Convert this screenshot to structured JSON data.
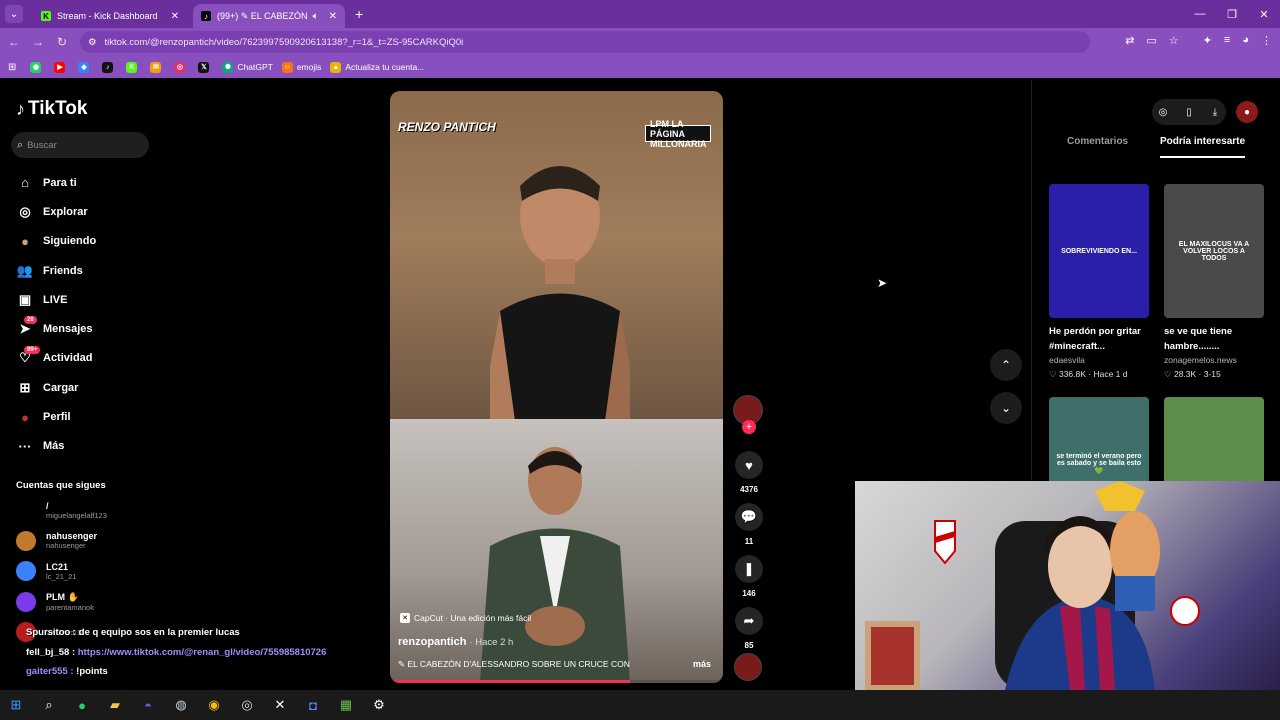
{
  "browser": {
    "tabs": [
      {
        "title": "Stream - Kick Dashboard",
        "favicon": "K",
        "favicon_color": "#53fc18"
      },
      {
        "title": "(99+) ✎ EL CABEZÓN D'",
        "favicon": "♪",
        "favicon_color": "#000000"
      }
    ],
    "url": "tiktok.com/@renzopantich/video/7623997590920613138?_r=1&_t=ZS-95CARKQiQ0i",
    "bookmarks": [
      {
        "label": "",
        "icon": "whatsapp-icon",
        "glyph": "◉",
        "color": "#25d366"
      },
      {
        "label": "",
        "icon": "youtube-icon",
        "glyph": "▶",
        "color": "#ff0000"
      },
      {
        "label": "",
        "icon": "messenger-icon",
        "glyph": "◈",
        "color": "#3b82f6"
      },
      {
        "label": "",
        "icon": "tiktok-icon",
        "glyph": "♪",
        "color": "#111111"
      },
      {
        "label": "",
        "icon": "kick-icon",
        "glyph": "K",
        "color": "#53fc18"
      },
      {
        "label": "",
        "icon": "mail-icon",
        "glyph": "✉",
        "color": "#f59e0b"
      },
      {
        "label": "",
        "icon": "instagram-icon",
        "glyph": "◎",
        "color": "#e1306c"
      },
      {
        "label": "",
        "icon": "x-icon",
        "glyph": "𝕏",
        "color": "#111111"
      },
      {
        "label": "ChatGPT",
        "icon": "chatgpt-icon",
        "glyph": "✺",
        "color": "#10a37f"
      },
      {
        "label": "emojis",
        "icon": "emoji-icon",
        "glyph": "☺",
        "color": "#f97316"
      },
      {
        "label": "Actualiza tu cuenta...",
        "icon": "bookmark-icon",
        "glyph": "▲",
        "color": "#eab308"
      }
    ]
  },
  "tiktok": {
    "logo": "TikTok",
    "search_placeholder": "Buscar",
    "menu": [
      {
        "label": "Para ti",
        "icon": "home-icon",
        "glyph": "⌂"
      },
      {
        "label": "Explorar",
        "icon": "compass-icon",
        "glyph": "◎"
      },
      {
        "label": "Siguiendo",
        "icon": "following-avatar-icon",
        "glyph": "●"
      },
      {
        "label": "Friends",
        "icon": "friends-icon",
        "glyph": "👥"
      },
      {
        "label": "LIVE",
        "icon": "live-icon",
        "glyph": "▣"
      },
      {
        "label": "Mensajes",
        "icon": "messages-icon",
        "glyph": "➤",
        "badge": "26"
      },
      {
        "label": "Actividad",
        "icon": "activity-icon",
        "glyph": "♡",
        "badge": "99+"
      },
      {
        "label": "Cargar",
        "icon": "upload-icon",
        "glyph": "⊞"
      },
      {
        "label": "Perfil",
        "icon": "profile-icon",
        "glyph": "●"
      },
      {
        "label": "Más",
        "icon": "more-icon",
        "glyph": "···"
      }
    ],
    "following_title": "Cuentas que sigues",
    "following": [
      {
        "name": "/",
        "handle": "miguelangelalf123",
        "color": "#000000"
      },
      {
        "name": "nahusenger",
        "handle": "nahusenger",
        "color": "#c2772f"
      },
      {
        "name": "LC21",
        "handle": "lc_21_21",
        "color": "#3b82f6"
      },
      {
        "name": "PLM ✋",
        "handle": "parentamanok",
        "color": "#7c3aed"
      },
      {
        "name": "",
        "handle": "benitosdr10",
        "color": "#b91c1c"
      }
    ]
  },
  "video": {
    "watermark": "RENZO PANTICH",
    "lpm_label": "LPM LA PÁGINA MILLONARIA",
    "capcut": "CapCut · Una edición más fácil",
    "author": "renzopantich",
    "time": "· Hace 2 h",
    "description": "✎ EL CABEZÓN D'ALESSANDRO SOBRE UN CRUCE CON",
    "more": "más",
    "progress": 0.72,
    "actions": [
      {
        "name": "like",
        "icon": "heart-icon",
        "glyph": "♥",
        "count": "4376"
      },
      {
        "name": "comment",
        "icon": "comment-icon",
        "glyph": "💬",
        "count": "11"
      },
      {
        "name": "save",
        "icon": "bookmark-icon",
        "glyph": "❚",
        "count": "146"
      },
      {
        "name": "share",
        "icon": "share-icon",
        "glyph": "➦",
        "count": "85"
      }
    ]
  },
  "right_panel": {
    "tabs": [
      "Comentarios",
      "Podría interesarte"
    ],
    "cards": [
      {
        "title": "He perdón por gritar #minecraft...",
        "user": "edaesvila",
        "stats": "♡ 336.8K · Hace 1 d",
        "thumb_text": "SOBREVIVIENDO EN...",
        "bg": "#2a1fa8"
      },
      {
        "title": "se ve que tiene hambre........",
        "user": "zonagemelos.news",
        "stats": "♡ 28.3K · 3-15",
        "thumb_text": "EL MAXILOCUS VA A VOLVER LOCOS A TODOS",
        "bg": "#4a4a4a"
      },
      {
        "title": "",
        "user": "",
        "stats": "",
        "thumb_text": "se terminó el verano pero es sabado y se baila esto 💚",
        "bg": "#3f6f6a"
      },
      {
        "title": "",
        "user": "",
        "stats": "",
        "thumb_text": "",
        "bg": "#5b8f4a"
      }
    ]
  },
  "chat": [
    {
      "user": "Spursitoo :",
      "text": "de q equipo sos en la premier lucas"
    },
    {
      "user": "fell_bj_58 :",
      "text": "https://www.tiktok.com/@renan_gl/video/755985810726"
    },
    {
      "user": "gaiter555 :",
      "text": "!points"
    }
  ],
  "taskbar": [
    {
      "icon": "windows-icon",
      "glyph": "⊞",
      "color": "#3b9cff"
    },
    {
      "icon": "search-icon",
      "glyph": "⌕",
      "color": "#ffffff"
    },
    {
      "icon": "spotify-icon",
      "glyph": "●",
      "color": "#1ed760"
    },
    {
      "icon": "folder-icon",
      "glyph": "▰",
      "color": "#f5c542"
    },
    {
      "icon": "discord-icon",
      "glyph": "◓",
      "color": "#5865f2"
    },
    {
      "icon": "steam-icon",
      "glyph": "◍",
      "color": "#c7d5e0"
    },
    {
      "icon": "chrome-icon",
      "glyph": "◉",
      "color": "#fbbc04"
    },
    {
      "icon": "obs-icon",
      "glyph": "◎",
      "color": "#dddddd"
    },
    {
      "icon": "capcut-icon",
      "glyph": "✕",
      "color": "#ffffff"
    },
    {
      "icon": "app-icon",
      "glyph": "◘",
      "color": "#4f8cff"
    },
    {
      "icon": "minecraft-icon",
      "glyph": "▦",
      "color": "#6abf4b"
    },
    {
      "icon": "settings-icon",
      "glyph": "⚙",
      "color": "#ffffff"
    }
  ]
}
